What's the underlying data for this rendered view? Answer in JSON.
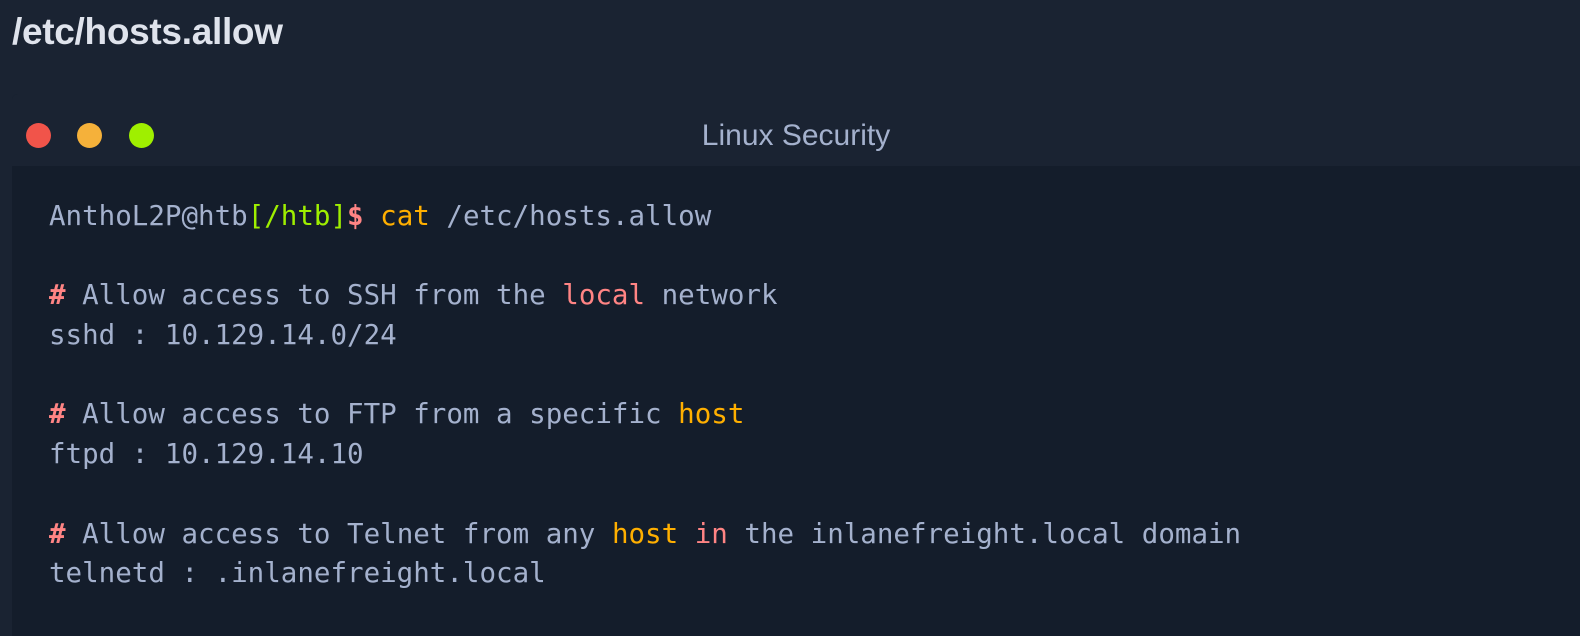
{
  "page_title": "/etc/hosts.allow",
  "window": {
    "title": "Linux Security",
    "controls": [
      "close",
      "minimize",
      "maximize"
    ],
    "control_colors": {
      "close": "#f1544a",
      "minimize": "#f5b13a",
      "maximize": "#9fef00"
    }
  },
  "terminal": {
    "prompt": {
      "user_host": "AnthoL2P@htb",
      "path": "[/htb]",
      "symbol": "$",
      "command": "cat",
      "args": " /etc/hosts.allow"
    },
    "blocks": [
      {
        "comment_hash": "#",
        "comment_parts": [
          " Allow access to SSH from the ",
          "local",
          " network"
        ],
        "rule": "sshd : 10.129.14.0/24"
      },
      {
        "comment_hash": "#",
        "comment_parts": [
          " Allow access to FTP from a specific ",
          "host"
        ],
        "rule": "ftpd : 10.129.14.10"
      },
      {
        "comment_hash": "#",
        "comment_parts": [
          " Allow access to Telnet from any ",
          "host",
          " ",
          "in",
          " the inlanefreight.local domain"
        ],
        "rule": "telnetd : .inlanefreight.local"
      }
    ]
  },
  "colors": {
    "background": "#1a2332",
    "terminal_bg": "#141d2b",
    "text": "#a4b1cd",
    "green": "#9fef00",
    "red": "#ff8484",
    "yellow": "#ffaf00"
  }
}
